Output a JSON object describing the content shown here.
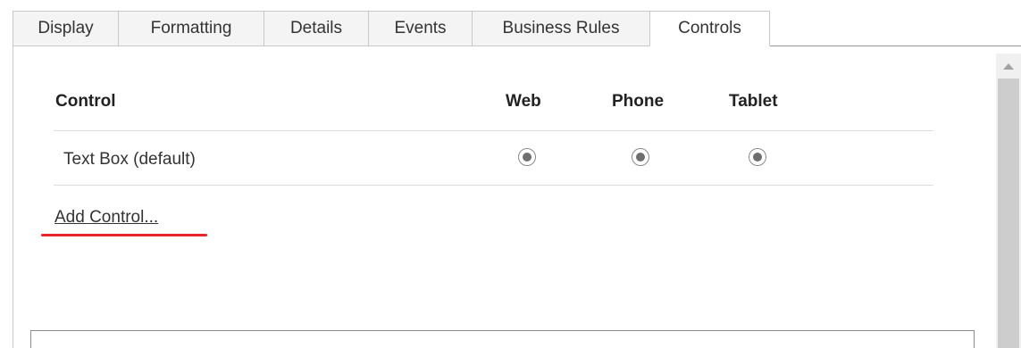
{
  "tabs": [
    {
      "label": "Display",
      "active": false
    },
    {
      "label": "Formatting",
      "active": false
    },
    {
      "label": "Details",
      "active": false
    },
    {
      "label": "Events",
      "active": false
    },
    {
      "label": "Business Rules",
      "active": false
    },
    {
      "label": "Controls",
      "active": true
    }
  ],
  "grid": {
    "headers": {
      "control": "Control",
      "web": "Web",
      "phone": "Phone",
      "tablet": "Tablet"
    },
    "rows": [
      {
        "label": "Text Box (default)",
        "web": "selected",
        "phone": "selected",
        "tablet": "selected"
      }
    ]
  },
  "add_control_label": "Add Control...",
  "colors": {
    "annotation_underline": "#e8232a",
    "tab_border": "#c8c8c8",
    "radio_dot": "#6e6e6e"
  }
}
